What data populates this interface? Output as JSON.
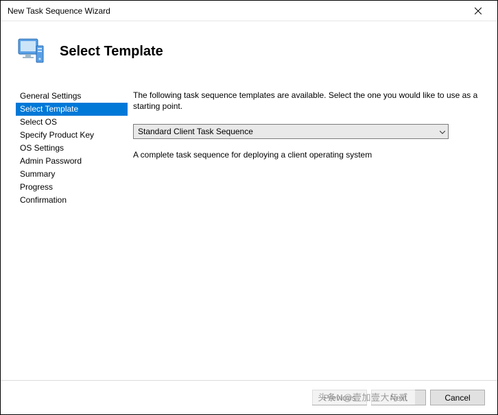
{
  "window": {
    "title": "New Task Sequence Wizard"
  },
  "header": {
    "page_title": "Select Template"
  },
  "sidebar": {
    "items": [
      {
        "label": "General Settings",
        "selected": false
      },
      {
        "label": "Select Template",
        "selected": true
      },
      {
        "label": "Select OS",
        "selected": false
      },
      {
        "label": "Specify Product Key",
        "selected": false
      },
      {
        "label": "OS Settings",
        "selected": false
      },
      {
        "label": "Admin Password",
        "selected": false
      },
      {
        "label": "Summary",
        "selected": false
      },
      {
        "label": "Progress",
        "selected": false
      },
      {
        "label": "Confirmation",
        "selected": false
      }
    ]
  },
  "main": {
    "instruction": "The following task sequence templates are available.  Select the one you would like to use as a starting point.",
    "dropdown_value": "Standard Client Task Sequence",
    "description": "A complete task sequence for deploying a client operating system"
  },
  "buttons": {
    "previous": "Previous",
    "next": "Next",
    "cancel": "Cancel"
  },
  "watermark": "头条N@壹加壹大与贰"
}
